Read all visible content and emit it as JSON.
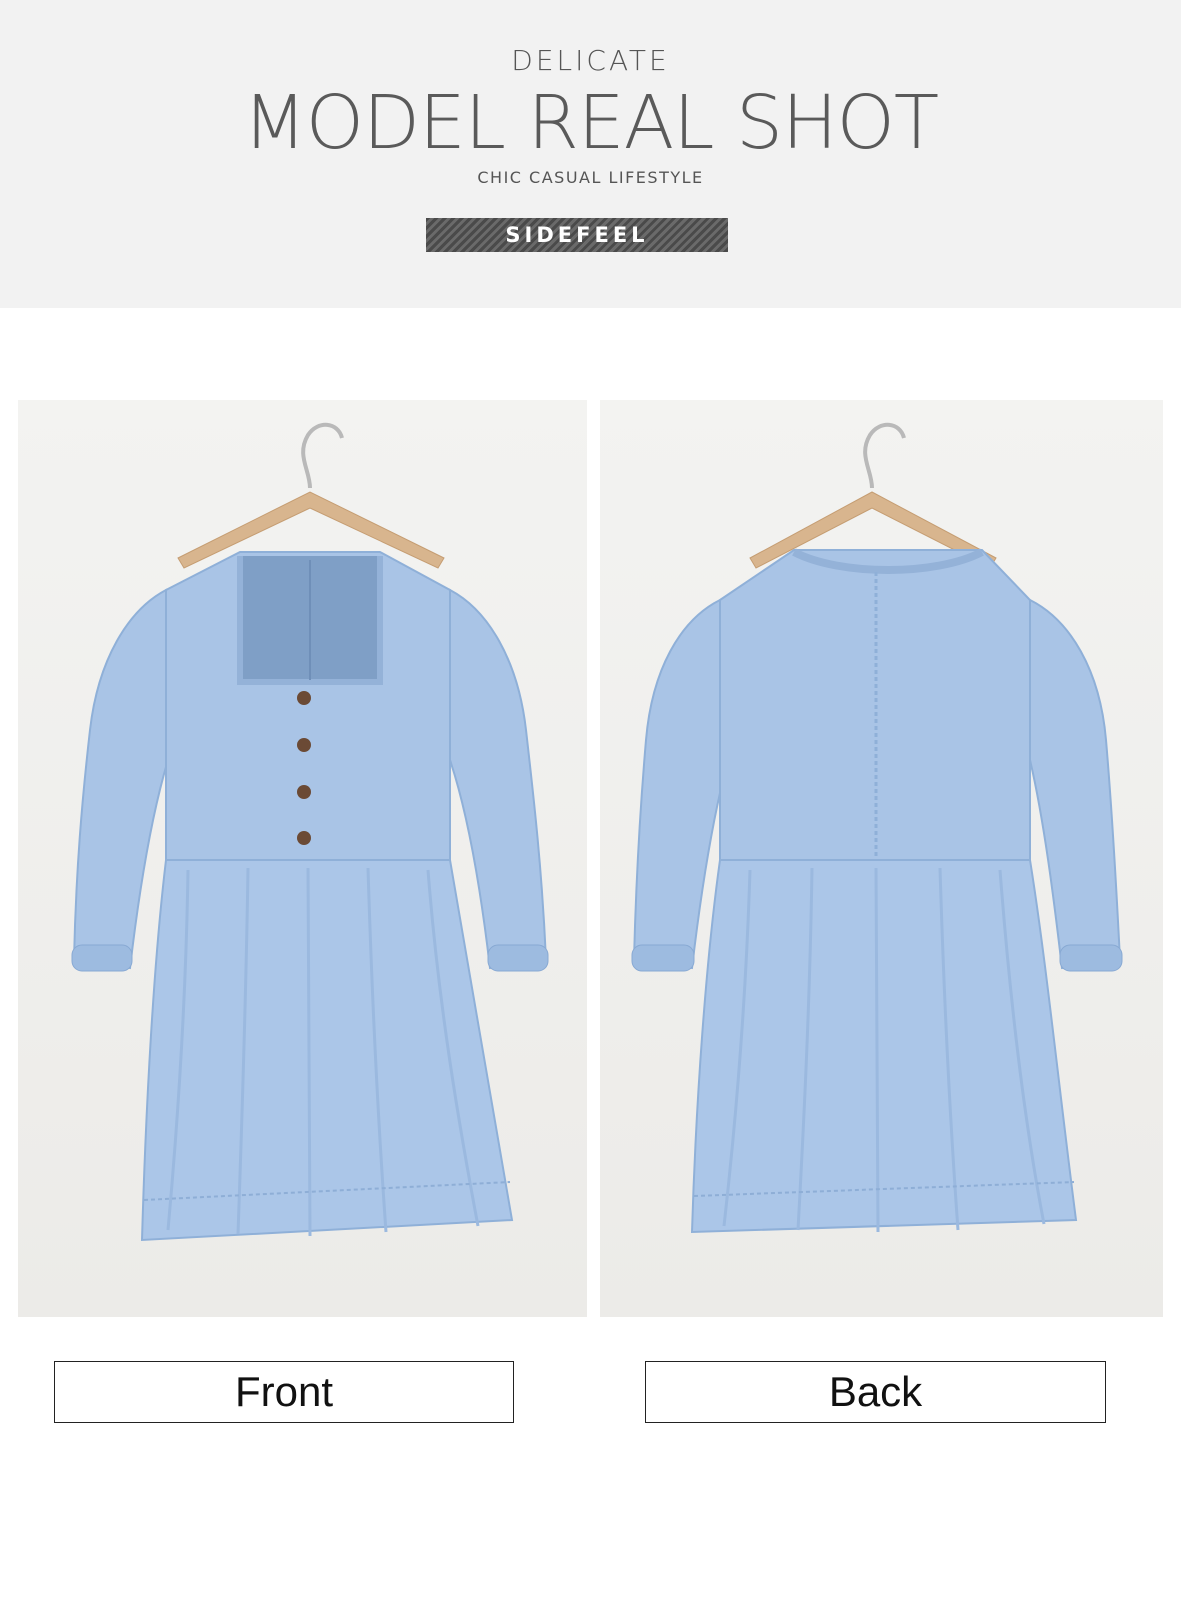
{
  "banner": {
    "kicker": "DELICATE",
    "headline": "MODEL REAL SHOT",
    "tagline": "CHIC CASUAL LIFESTYLE",
    "brand": "SIDEFEEL"
  },
  "photos": {
    "front": {
      "subject": "dress-front-on-hanger",
      "caption": "Front"
    },
    "back": {
      "subject": "dress-back-on-hanger",
      "caption": "Back"
    }
  },
  "colors": {
    "banner_bg": "#f2f2f2",
    "denim": "#a9c4e6",
    "denim_shadow": "#8fb0d8",
    "hanger_wood": "#d8b58e",
    "button": "#6b4a35"
  }
}
